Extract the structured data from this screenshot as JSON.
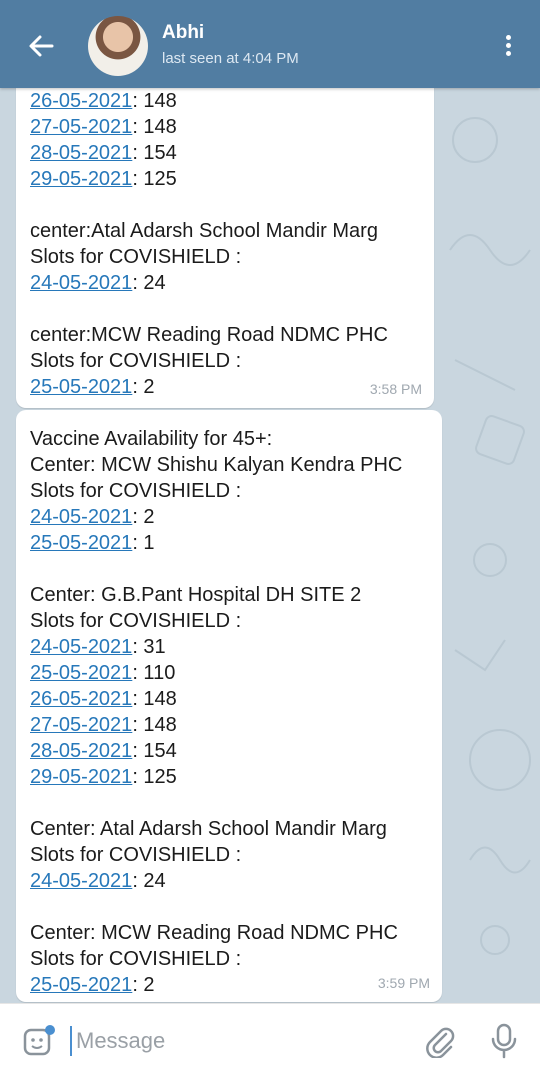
{
  "header": {
    "title": "Abhi",
    "subtitle": "last seen at 4:04 PM"
  },
  "messages": [
    {
      "time": "3:58 PM",
      "lines": [
        {
          "date": "26-05-2021",
          "count": ": 148"
        },
        {
          "date": "27-05-2021",
          "count": ": 148"
        },
        {
          "date": "28-05-2021",
          "count": ": 154"
        },
        {
          "date": "29-05-2021",
          "count": ": 125"
        },
        {
          "gap": true
        },
        {
          "text": "center:Atal Adarsh School Mandir Marg"
        },
        {
          "text": "Slots for COVISHIELD :"
        },
        {
          "date": "24-05-2021",
          "count": ": 24"
        },
        {
          "gap": true
        },
        {
          "text": "center:MCW Reading Road NDMC PHC"
        },
        {
          "text": "Slots for COVISHIELD :"
        },
        {
          "date": "25-05-2021",
          "count": ": 2"
        }
      ]
    },
    {
      "time": "3:59 PM",
      "lines": [
        {
          "text": "Vaccine Availability for 45+:"
        },
        {
          "text": "Center: MCW Shishu Kalyan Kendra PHC"
        },
        {
          "text": "Slots for COVISHIELD :"
        },
        {
          "date": "24-05-2021",
          "count": ": 2"
        },
        {
          "date": "25-05-2021",
          "count": ": 1"
        },
        {
          "gap": true
        },
        {
          "text": "Center: G.B.Pant Hospital DH SITE 2"
        },
        {
          "text": "Slots for COVISHIELD :"
        },
        {
          "date": "24-05-2021",
          "count": ": 31"
        },
        {
          "date": "25-05-2021",
          "count": ": 110"
        },
        {
          "date": "26-05-2021",
          "count": ": 148"
        },
        {
          "date": "27-05-2021",
          "count": ": 148"
        },
        {
          "date": "28-05-2021",
          "count": ": 154"
        },
        {
          "date": "29-05-2021",
          "count": ": 125"
        },
        {
          "gap": true
        },
        {
          "text": "Center: Atal Adarsh School Mandir Marg"
        },
        {
          "text": "Slots for COVISHIELD :"
        },
        {
          "date": "24-05-2021",
          "count": ": 24"
        },
        {
          "gap": true
        },
        {
          "text": "Center: MCW Reading Road NDMC PHC"
        },
        {
          "text": "Slots for COVISHIELD :"
        },
        {
          "date": "25-05-2021",
          "count": ": 2"
        }
      ]
    }
  ],
  "composer": {
    "placeholder": "Message"
  },
  "icons": {
    "back": "back-arrow-icon",
    "menu": "more-vertical-icon",
    "emoji": "sticker-emoji-icon",
    "attach": "paperclip-icon",
    "mic": "microphone-icon"
  },
  "colors": {
    "header": "#517da2",
    "link": "#2778ba",
    "chat_bg": "#c9d6df",
    "bubble": "#ffffff",
    "cursor": "#4a8fd0"
  }
}
